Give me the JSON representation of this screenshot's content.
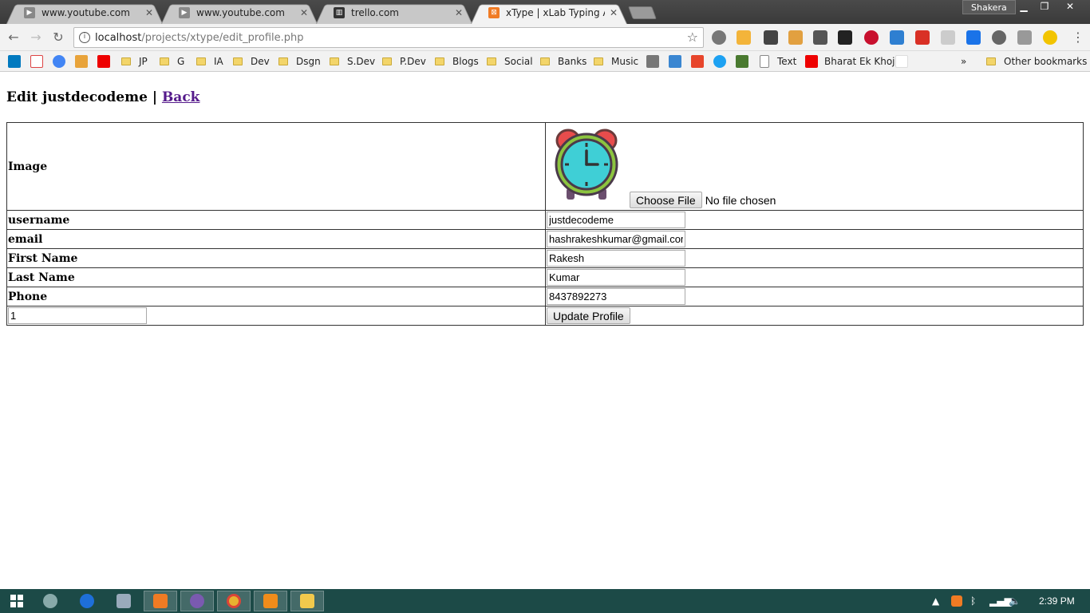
{
  "browser": {
    "tabs": [
      {
        "title": "www.youtube.com",
        "icon": "youtube-favicon",
        "active": false
      },
      {
        "title": "www.youtube.com",
        "icon": "youtube-favicon",
        "active": false
      },
      {
        "title": "trello.com",
        "icon": "trello-favicon",
        "active": false
      },
      {
        "title": "xType | xLab Typing App",
        "icon": "xampp-favicon",
        "active": true
      }
    ],
    "profile_name": "Shakera",
    "url_host": "localhost",
    "url_path": "/projects/xtype/edit_profile.php",
    "bookmarks": [
      {
        "label": "JP"
      },
      {
        "label": "G"
      },
      {
        "label": "IA"
      },
      {
        "label": "Dev"
      },
      {
        "label": "Dsgn"
      },
      {
        "label": "S.Dev"
      },
      {
        "label": "P.Dev"
      },
      {
        "label": "Blogs"
      },
      {
        "label": "Social"
      },
      {
        "label": "Banks"
      },
      {
        "label": "Music"
      }
    ],
    "bookmark_text": "Text",
    "bookmark_bharat": "Bharat Ek Khoj",
    "overflow": "»",
    "other_bookmarks": "Other bookmarks"
  },
  "page": {
    "heading_prefix": "Edit justdecodeme |",
    "back_link": "Back",
    "rows": {
      "image_label": "Image",
      "username_label": "username",
      "username_value": "justdecodeme",
      "email_label": "email",
      "email_value": "hashrakeshkumar@gmail.com",
      "first_name_label": "First Name",
      "first_name_value": "Rakesh",
      "last_name_label": "Last Name",
      "last_name_value": "Kumar",
      "phone_label": "Phone",
      "phone_value": "8437892273",
      "id_value": "1"
    },
    "choose_file_label": "Choose File",
    "file_status": "No file chosen",
    "update_button": "Update Profile"
  },
  "taskbar": {
    "time": "2:39 PM"
  },
  "colors": {
    "taskbar": "#1c4a47",
    "link": "#551a8b",
    "clock_face": "#3fcfd6",
    "clock_bells": "#e84c4c"
  }
}
